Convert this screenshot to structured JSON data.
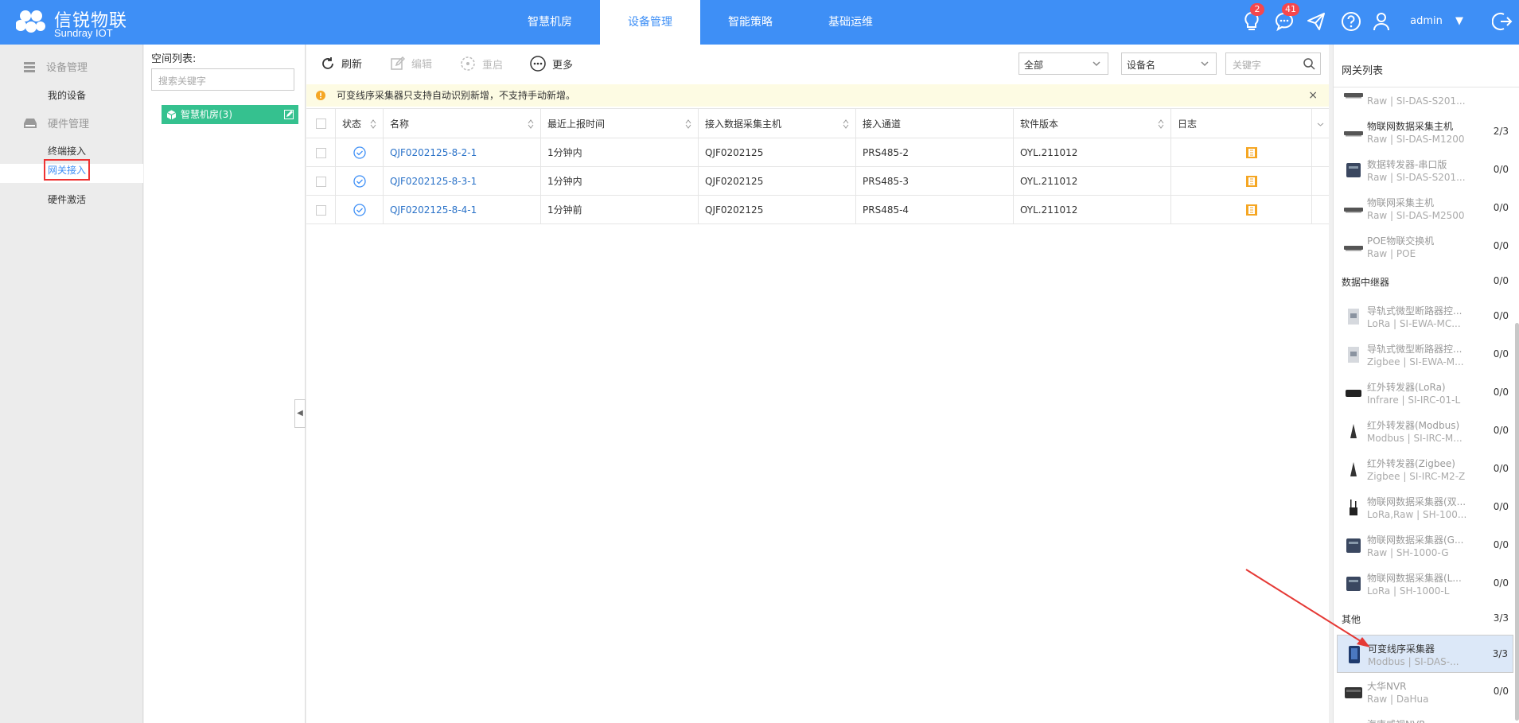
{
  "brand": {
    "name_cn": "信锐物联",
    "name_en": "Sundray IOT"
  },
  "nav": {
    "tabs": [
      {
        "label": "智慧机房"
      },
      {
        "label": "设备管理"
      },
      {
        "label": "智能策略"
      },
      {
        "label": "基础运维"
      }
    ],
    "active_index": 1
  },
  "header": {
    "bulb_badge": "2",
    "message_badge": "41",
    "user": "admin"
  },
  "sidebar": {
    "groups": [
      {
        "label": "设备管理",
        "items": [
          "我的设备"
        ]
      },
      {
        "label": "硬件管理",
        "items": [
          "终端接入",
          "网关接入",
          "硬件激活"
        ]
      }
    ]
  },
  "tree": {
    "title": "空间列表:",
    "search_placeholder": "搜索关键字",
    "node": "智慧机房(3)"
  },
  "toolbar": {
    "refresh": "刷新",
    "edit": "编辑",
    "restart": "重启",
    "more": "更多",
    "filter_value": "全部",
    "field_value": "设备名",
    "keyword_placeholder": "关键字"
  },
  "notice": {
    "text": "可变线序采集器只支持自动识别新增，不支持手动新增。",
    "close": "×"
  },
  "table": {
    "headers": [
      "状态",
      "名称",
      "最近上报时间",
      "接入数据采集主机",
      "接入通道",
      "软件版本",
      "日志"
    ],
    "rows": [
      {
        "name": "QJF0202125-8-2-1",
        "time": "1分钟内",
        "host": "QJF0202125",
        "channel": "PRS485-2",
        "version": "OYL.211012"
      },
      {
        "name": "QJF0202125-8-3-1",
        "time": "1分钟内",
        "host": "QJF0202125",
        "channel": "PRS485-3",
        "version": "OYL.211012"
      },
      {
        "name": "QJF0202125-8-4-1",
        "time": "1分钟前",
        "host": "QJF0202125",
        "channel": "PRS485-4",
        "version": "OYL.211012"
      }
    ]
  },
  "right_panel": {
    "title": "网关列表",
    "items": [
      {
        "kind": "item",
        "name": "",
        "sub": "Raw | SI-DAS-S201...",
        "count": "",
        "thumb": "flat"
      },
      {
        "kind": "item",
        "name": "物联网数据采集主机",
        "sub": "Raw | SI-DAS-M1200",
        "count": "2/3",
        "thumb": "flat"
      },
      {
        "kind": "item",
        "name": "数据转发器-串口版",
        "sub": "Raw | SI-DAS-S201...",
        "count": "0/0",
        "thumb": "box",
        "faded": true
      },
      {
        "kind": "item",
        "name": "物联网采集主机",
        "sub": "Raw | SI-DAS-M2500",
        "count": "0/0",
        "thumb": "flat",
        "faded": true
      },
      {
        "kind": "item",
        "name": "POE物联交换机",
        "sub": "Raw | POE",
        "count": "0/0",
        "thumb": "flat",
        "faded": true
      },
      {
        "kind": "group",
        "name": "数据中继器",
        "count": "0/0"
      },
      {
        "kind": "item",
        "name": "导轨式微型断路器控...",
        "sub": "LoRa | SI-EWA-MC...",
        "count": "0/0",
        "thumb": "rail",
        "faded": true
      },
      {
        "kind": "item",
        "name": "导轨式微型断路器控...",
        "sub": "Zigbee | SI-EWA-M...",
        "count": "0/0",
        "thumb": "rail",
        "faded": true
      },
      {
        "kind": "item",
        "name": "红外转发器(LoRa)",
        "sub": "Infrare | SI-IRC-01-L",
        "count": "0/0",
        "thumb": "dark",
        "faded": true
      },
      {
        "kind": "item",
        "name": "红外转发器(Modbus)",
        "sub": "Modbus | SI-IRC-M...",
        "count": "0/0",
        "thumb": "cone",
        "faded": true
      },
      {
        "kind": "item",
        "name": "红外转发器(Zigbee)",
        "sub": "Zigbee | SI-IRC-M2-Z",
        "count": "0/0",
        "thumb": "cone",
        "faded": true
      },
      {
        "kind": "item",
        "name": "物联网数据采集器(双...",
        "sub": "LoRa,Raw | SH-100...",
        "count": "0/0",
        "thumb": "antenna",
        "faded": true
      },
      {
        "kind": "item",
        "name": "物联网数据采集器(G...",
        "sub": "Raw | SH-1000-G",
        "count": "0/0",
        "thumb": "box",
        "faded": true
      },
      {
        "kind": "item",
        "name": "物联网数据采集器(L...",
        "sub": "LoRa | SH-1000-L",
        "count": "0/0",
        "thumb": "box",
        "faded": true
      },
      {
        "kind": "group",
        "name": "其他",
        "count": "3/3"
      },
      {
        "kind": "item",
        "name": "可变线序采集器",
        "sub": "Modbus | SI-DAS-...",
        "count": "3/3",
        "thumb": "blue",
        "selected": true
      },
      {
        "kind": "item",
        "name": "大华NVR",
        "sub": "Raw | DaHua",
        "count": "0/0",
        "thumb": "nvr",
        "faded": true
      },
      {
        "kind": "item",
        "name": "海康威视NVR",
        "sub": "",
        "count": "",
        "thumb": "nvr",
        "faded": true
      }
    ]
  },
  "colors": {
    "primary": "#3e8ff6",
    "tree_node": "#35c18f",
    "badge": "#f5474d",
    "annotation": "#e53935"
  }
}
